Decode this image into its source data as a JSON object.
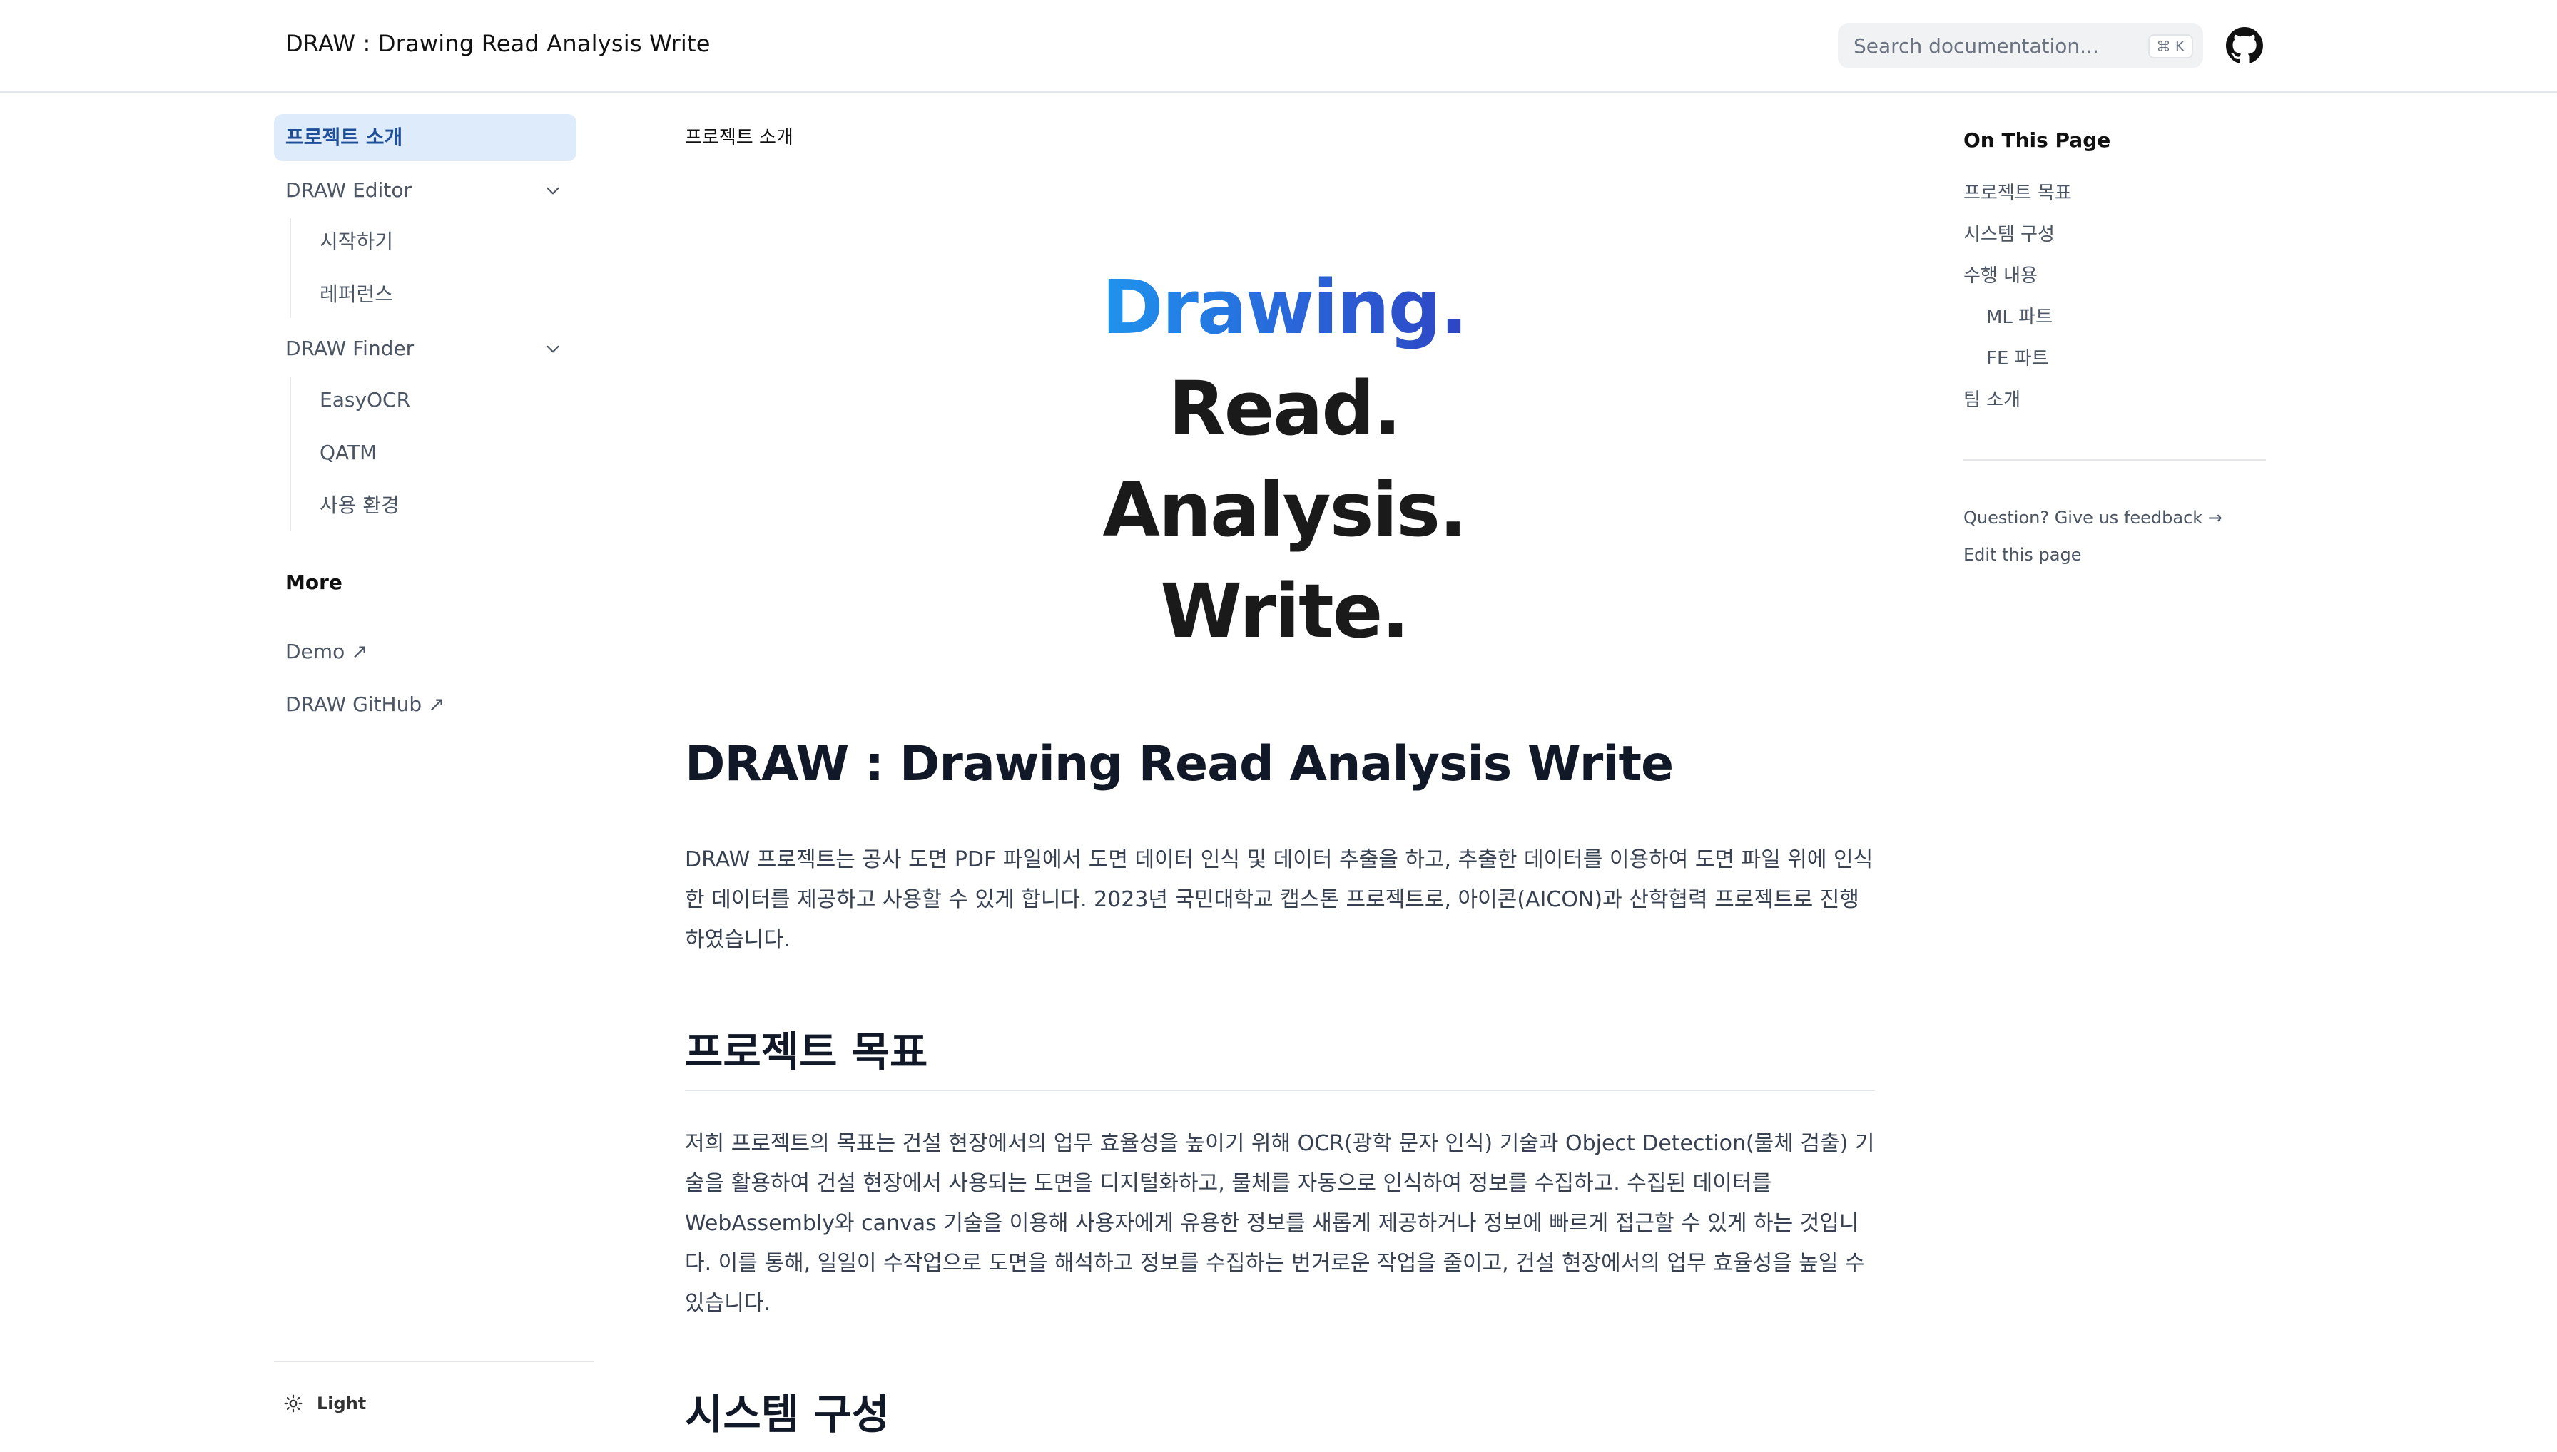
{
  "header": {
    "site_title": "DRAW : Drawing Read Analysis Write",
    "search_placeholder": "Search documentation...",
    "search_shortcut": "⌘ K",
    "github_icon": "github-icon"
  },
  "sidebar": {
    "items": [
      {
        "label": "프로젝트 소개",
        "active": true
      },
      {
        "label": "DRAW Editor",
        "expanded": true,
        "children": [
          "시작하기",
          "레퍼런스"
        ]
      },
      {
        "label": "DRAW Finder",
        "expanded": true,
        "children": [
          "EasyOCR",
          "QATM",
          "사용 환경"
        ]
      }
    ],
    "more_title": "More",
    "more_links": [
      "Demo ↗",
      "DRAW GitHub ↗"
    ],
    "theme_label": "Light"
  },
  "main": {
    "breadcrumb": "프로젝트 소개",
    "hero_lines": [
      "Drawing.",
      "Read.",
      "Analysis.",
      "Write."
    ],
    "title": "DRAW : Drawing Read Analysis Write",
    "intro": "DRAW 프로젝트는 공사 도면 PDF 파일에서 도면 데이터 인식 및 데이터 추출을 하고, 추출한 데이터를 이용하여 도면 파일 위에 인식한 데이터를 제공하고 사용할 수 있게 합니다. 2023년 국민대학교 캡스톤 프로젝트로, 아이콘(AICON)과 산학협력 프로젝트로 진행하였습니다.",
    "section1_title": "프로젝트 목표",
    "section1_text": "저희 프로젝트의 목표는 건설 현장에서의 업무 효율성을 높이기 위해 OCR(광학 문자 인식) 기술과 Object Detection(물체 검출) 기술을 활용하여 건설 현장에서 사용되는 도면을 디지털화하고, 물체를 자동으로 인식하여 정보를 수집하고. 수집된 데이터를 WebAssembly와 canvas 기술을 이용해 사용자에게 유용한 정보를 새롭게 제공하거나 정보에 빠르게 접근할 수 있게 하는 것입니다. 이를 통해, 일일이 수작업으로 도면을 해석하고 정보를 수집하는 번거로운 작업을 줄이고, 건설 현장에서의 업무 효율성을 높일 수 있습니다.",
    "section2_title": "시스템 구성"
  },
  "toc": {
    "title": "On This Page",
    "items": [
      {
        "label": "프로젝트 목표",
        "level": 1
      },
      {
        "label": "시스템 구성",
        "level": 1
      },
      {
        "label": "수행 내용",
        "level": 1
      },
      {
        "label": "ML 파트",
        "level": 2
      },
      {
        "label": "FE 파트",
        "level": 2
      },
      {
        "label": "팀 소개",
        "level": 1
      }
    ],
    "feedback_link": "Question? Give us feedback →",
    "edit_link": "Edit this page"
  },
  "colors": {
    "active_bg": "#deebfb",
    "active_text": "#1f4f99",
    "hero_gradient_start": "#1d9bf0",
    "hero_gradient_end": "#2f3fbf"
  }
}
